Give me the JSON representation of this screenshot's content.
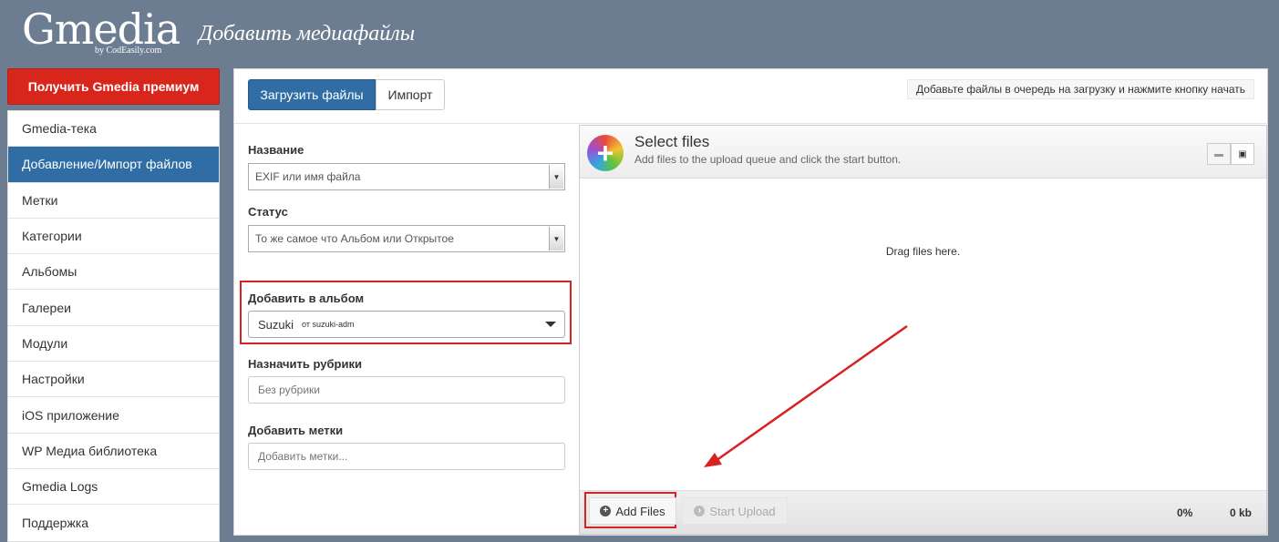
{
  "header": {
    "logo": "Gmedia",
    "logo_sub": "by CodEasily.com",
    "page_title": "Добавить медиафайлы"
  },
  "sidebar": {
    "premium_label": "Получить Gmedia премиум",
    "items": [
      {
        "label": "Gmedia-тека"
      },
      {
        "label": "Добавление/Импорт файлов",
        "active": true
      },
      {
        "label": "Метки"
      },
      {
        "label": "Категории"
      },
      {
        "label": "Альбомы"
      },
      {
        "label": "Галереи"
      },
      {
        "label": "Модули"
      },
      {
        "label": "Настройки"
      },
      {
        "label": "iOS приложение"
      },
      {
        "label": "WP Медиа библиотека"
      },
      {
        "label": "Gmedia Logs"
      },
      {
        "label": "Поддержка"
      }
    ]
  },
  "tabs": {
    "upload": "Загрузить файлы",
    "import": "Импорт"
  },
  "hint": "Добавьте файлы в очередь на загрузку и нажмите кнопку начать",
  "form": {
    "name_label": "Название",
    "name_value": "EXIF или имя файла",
    "status_label": "Статус",
    "status_value": "То же самое что Альбом или Открытое",
    "album_label": "Добавить в альбом",
    "album_value": "Suzuki",
    "album_owner": "от suzuki-adm",
    "categories_label": "Назначить рубрики",
    "categories_placeholder": "Без рубрики",
    "tags_label": "Добавить метки",
    "tags_placeholder": "Добавить метки..."
  },
  "uploader": {
    "title": "Select files",
    "subtitle": "Add files to the upload queue and click the start button.",
    "drop_text": "Drag files here.",
    "add_files": "Add Files",
    "start_upload": "Start Upload",
    "percent": "0%",
    "size": "0 kb",
    "annotation_color": "#d62222"
  }
}
